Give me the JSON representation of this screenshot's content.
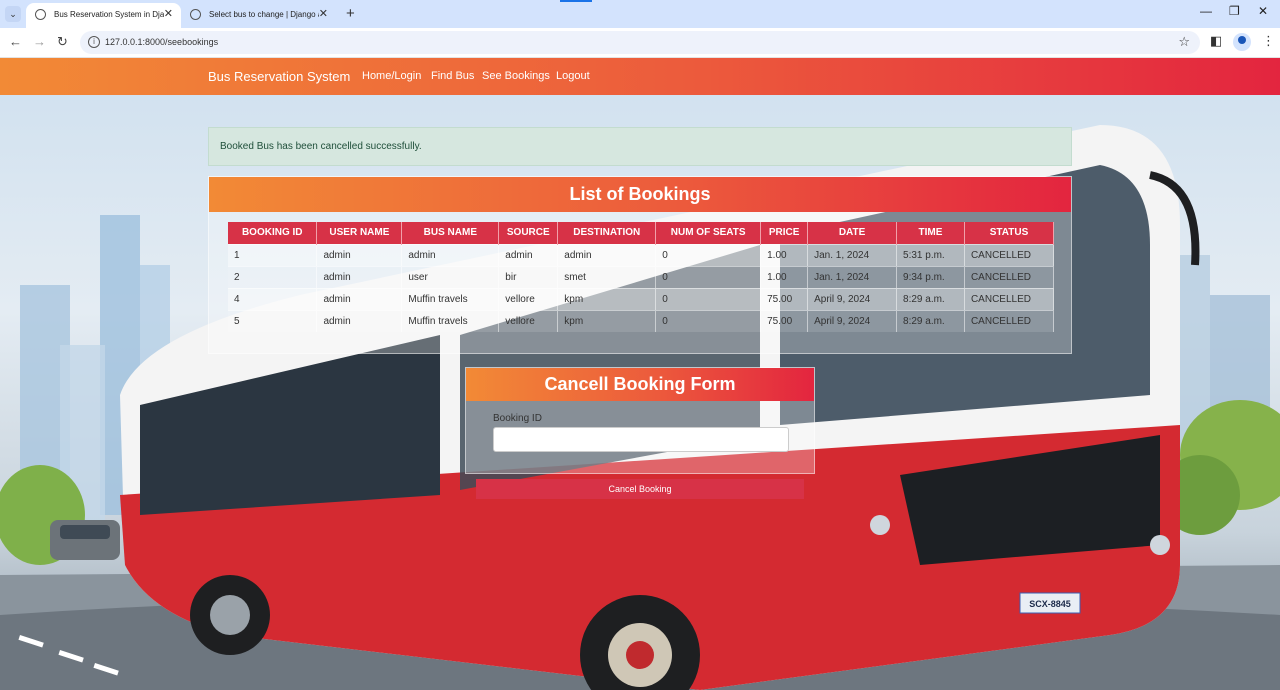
{
  "browser": {
    "tabs": [
      {
        "title": "Bus Reservation System in Djan",
        "active": true
      },
      {
        "title": "Select bus to change | Django a",
        "active": false
      }
    ],
    "url": "127.0.0.1:8000/seebookings"
  },
  "navbar": {
    "brand": "Bus Reservation System",
    "links": [
      "Home/Login",
      "Find Bus",
      "See Bookings",
      "Logout"
    ]
  },
  "alert": "Booked Bus has been cancelled successfully.",
  "bookings": {
    "title": "List of Bookings",
    "columns": [
      "BOOKING ID",
      "USER NAME",
      "BUS NAME",
      "SOURCE",
      "DESTINATION",
      "NUM OF SEATS",
      "PRICE",
      "DATE",
      "TIME",
      "STATUS"
    ],
    "rows": [
      [
        "1",
        "admin",
        "admin",
        "admin",
        "admin",
        "0",
        "1.00",
        "Jan. 1, 2024",
        "5:31 p.m.",
        "CANCELLED"
      ],
      [
        "2",
        "admin",
        "user",
        "bir",
        "smet",
        "0",
        "1.00",
        "Jan. 1, 2024",
        "9:34 p.m.",
        "CANCELLED"
      ],
      [
        "4",
        "admin",
        "Muffin travels",
        "vellore",
        "kpm",
        "0",
        "75.00",
        "April 9, 2024",
        "8:29 a.m.",
        "CANCELLED"
      ],
      [
        "5",
        "admin",
        "Muffin travels",
        "vellore",
        "kpm",
        "0",
        "75.00",
        "April 9, 2024",
        "8:29 a.m.",
        "CANCELLED"
      ]
    ]
  },
  "cancel_form": {
    "title": "Cancell Booking Form",
    "label": "Booking ID",
    "value": "",
    "submit": "Cancel Booking"
  },
  "plate": "SCX-8845",
  "colors": {
    "gradient_start": "#f28a36",
    "gradient_end": "#e3253f",
    "table_header": "#d73247",
    "alert_bg": "#d6e7df"
  }
}
